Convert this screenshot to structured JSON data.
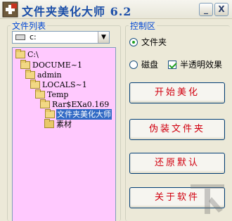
{
  "window": {
    "title": "文件夹美化大师 6.2",
    "minimize_glyph": "_",
    "close_glyph": "X"
  },
  "file_list": {
    "group_label": "文件列表",
    "drive": "c:",
    "tree": [
      {
        "label": "C:\\",
        "depth": 0
      },
      {
        "label": "DOCUME~1",
        "depth": 1
      },
      {
        "label": "admin",
        "depth": 2
      },
      {
        "label": "LOCALS~1",
        "depth": 3
      },
      {
        "label": "Temp",
        "depth": 4
      },
      {
        "label": "Rar$EXa0.169",
        "depth": 5
      },
      {
        "label": "文件夹美化大师",
        "depth": 6,
        "selected": true
      },
      {
        "label": "素材",
        "depth": 7
      }
    ]
  },
  "control": {
    "group_label": "控制区",
    "radio_folder": "文件夹",
    "radio_disk": "磁盘",
    "checkbox_translucent": "半透明效果",
    "folder_selected": true,
    "disk_selected": false,
    "translucent_checked": true,
    "buttons": {
      "start": "开始美化",
      "disguise": "伪装文件夹",
      "restore": "还原默认",
      "about": "关于软件"
    }
  },
  "colors": {
    "tree_bg": "#ffc9fe",
    "button_text": "#d1000f",
    "group_label": "#0046d5",
    "title": "#1b4ea8"
  }
}
